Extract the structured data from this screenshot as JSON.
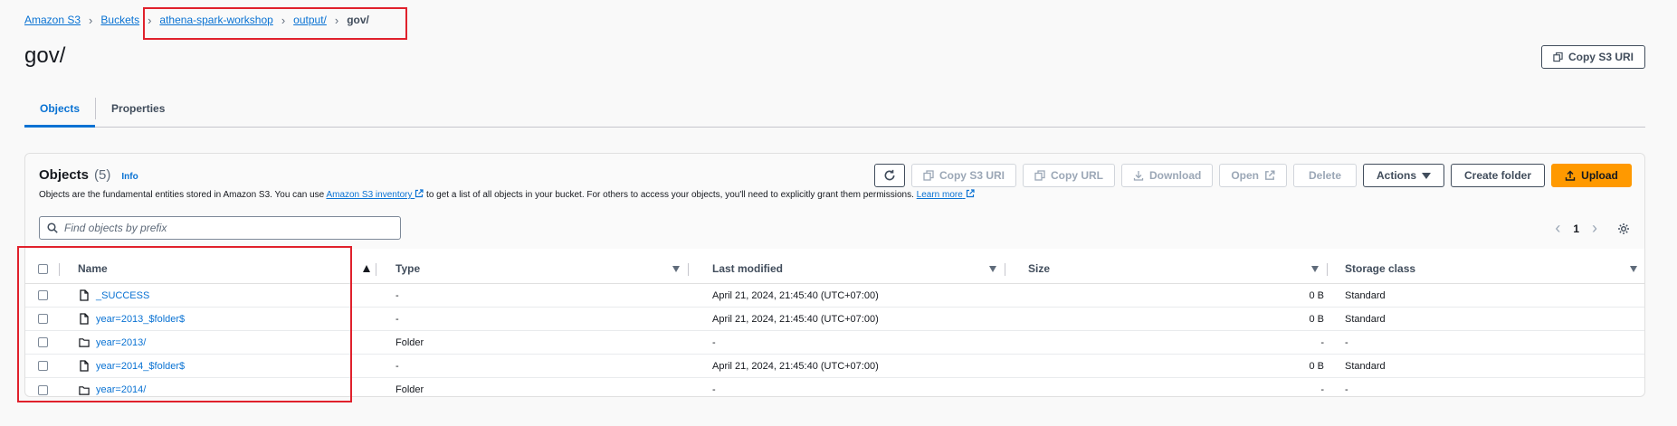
{
  "breadcrumb": {
    "items": [
      "Amazon S3",
      "Buckets",
      "athena-spark-workshop",
      "output/"
    ],
    "current": "gov/"
  },
  "page": {
    "title": "gov/",
    "copy_uri_label": "Copy S3 URI"
  },
  "tabs": [
    {
      "label": "Objects",
      "active": true
    },
    {
      "label": "Properties",
      "active": false
    }
  ],
  "objects": {
    "title": "Objects",
    "count": "(5)",
    "info": "Info",
    "description_pre": "Objects are the fundamental entities stored in Amazon S3. You can use ",
    "inventory_link": "Amazon S3 inventory",
    "description_mid": " to get a list of all objects in your bucket. For others to access your objects, you'll need to explicitly grant them permissions. ",
    "learn_more": "Learn more"
  },
  "toolbar": {
    "copy_s3_uri": "Copy S3 URI",
    "copy_url": "Copy URL",
    "download": "Download",
    "open": "Open",
    "delete": "Delete",
    "actions": "Actions",
    "create_folder": "Create folder",
    "upload": "Upload"
  },
  "search": {
    "placeholder": "Find objects by prefix"
  },
  "pagination": {
    "page": "1"
  },
  "table": {
    "columns": [
      "Name",
      "Type",
      "Last modified",
      "Size",
      "Storage class"
    ],
    "rows": [
      {
        "name": "_SUCCESS",
        "icon": "file-icon",
        "type": "-",
        "modified": "April 21, 2024, 21:45:40 (UTC+07:00)",
        "size": "0 B",
        "storage": "Standard"
      },
      {
        "name": "year=2013_$folder$",
        "icon": "file-icon",
        "type": "-",
        "modified": "April 21, 2024, 21:45:40 (UTC+07:00)",
        "size": "0 B",
        "storage": "Standard"
      },
      {
        "name": "year=2013/",
        "icon": "folder-icon",
        "type": "Folder",
        "modified": "-",
        "size": "-",
        "storage": "-"
      },
      {
        "name": "year=2014_$folder$",
        "icon": "file-icon",
        "type": "-",
        "modified": "April 21, 2024, 21:45:40 (UTC+07:00)",
        "size": "0 B",
        "storage": "Standard"
      },
      {
        "name": "year=2014/",
        "icon": "folder-icon",
        "type": "Folder",
        "modified": "-",
        "size": "-",
        "storage": "-"
      }
    ]
  },
  "colors": {
    "link": "#0972d3",
    "primary": "#ff9900",
    "highlight": "#e0212c"
  }
}
